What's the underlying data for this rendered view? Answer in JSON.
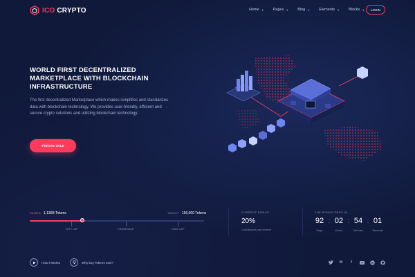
{
  "header": {
    "logo_prefix": "ICO",
    "logo_suffix": "CRYPTO",
    "nav": [
      {
        "label": "Home"
      },
      {
        "label": "Pages"
      },
      {
        "label": "Blog"
      },
      {
        "label": "Elements"
      },
      {
        "label": "Blocks"
      }
    ],
    "login_label": "LOGIN"
  },
  "hero": {
    "title": "WORLD FIRST DECENTRALIZED\nMARKETPLACE WITH BLOCKCHAIN\nINFRASTRUCTURE",
    "description": "The first decentralized Marketplace which makes simplifies and standarizes data with blockchain technology. We provides user-friendly, efficient and secure crypto solutions and utilizing blockchain technology.",
    "cta_label": "PRIVATE SALE"
  },
  "progress": {
    "raised_label": "RAISED",
    "raised_value": "1,135B Tokens",
    "target_label": "TARGET",
    "target_value": "150,000 Tokens",
    "fill_fraction": 0.3,
    "markers": [
      {
        "label": "SOFT CAP",
        "fraction": 0.24
      },
      {
        "label": "CROWDSALE",
        "fraction": 0.55
      },
      {
        "label": "HARD CAP",
        "fraction": 0.85
      }
    ]
  },
  "bonus": {
    "title": "CURRENT BONUS",
    "value": "20%",
    "note": "Contributors can receive"
  },
  "countdown": {
    "title": "THE BONUS ENDS IN",
    "units": [
      {
        "value": "92",
        "label": "Days"
      },
      {
        "value": "02",
        "label": "Hours"
      },
      {
        "value": "54",
        "label": "Minutes"
      },
      {
        "value": "01",
        "label": "Seconds"
      }
    ]
  },
  "footer": {
    "how_label": "How it Works",
    "why_label": "Why buy Tokens now?",
    "social": [
      "twitter-icon",
      "medium-icon",
      "facebook-icon",
      "youtube-icon",
      "bitcoin-icon",
      "github-icon"
    ]
  },
  "colors": {
    "background": "#10193a",
    "accent": "#ff3b5c",
    "muted": "#8a93b8"
  }
}
